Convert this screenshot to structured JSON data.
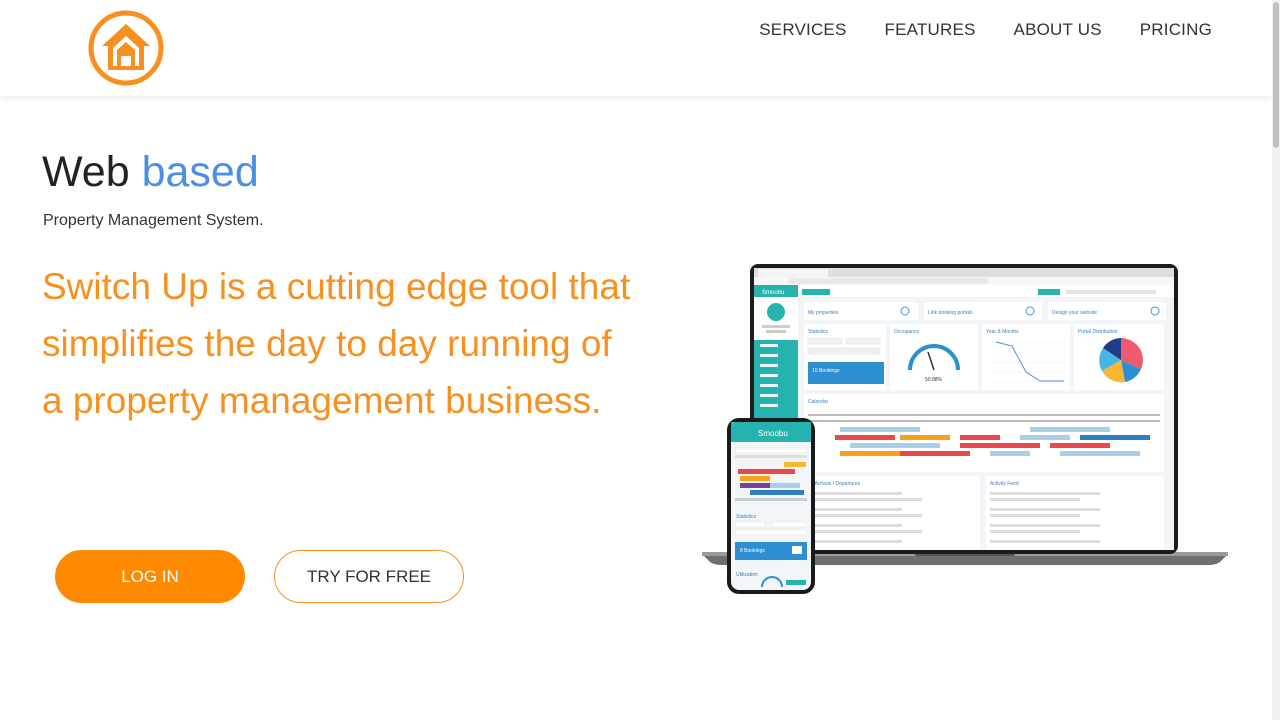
{
  "header": {
    "logo": {
      "icon": "house-icon",
      "color": "#f7901e"
    },
    "nav": [
      {
        "label": "SERVICES"
      },
      {
        "label": "FEATURES"
      },
      {
        "label": "ABOUT US"
      },
      {
        "label": "PRICING"
      }
    ]
  },
  "hero": {
    "headline_part1": "Web",
    "headline_part2": "based",
    "subheadline": "Property Management System.",
    "tagline": "Switch Up is a cutting edge tool that simplifies the day to day running of a property management business.",
    "buttons": {
      "login_label": "LOG IN",
      "try_label": "TRY FOR FREE"
    }
  },
  "mockup": {
    "laptop": {
      "brand": "Smoobu",
      "panels": {
        "my_properties": "My properties",
        "link_portals": "Link booking portals",
        "design_website": "Design your website",
        "statistics": "Statistics",
        "occupancy": "Occupancy",
        "year_months": "Year & Months",
        "portal_distribution": "Portal Distribution",
        "calendar": "Calendar",
        "arrivals": "All Arrivals / Departures",
        "activity": "Activity Feed",
        "bookings": "10 Bookings",
        "occupancy_value": "50.88%"
      }
    },
    "phone": {
      "brand": "Smoobu",
      "statistics": "Statistics",
      "bookings": "8 Bookings",
      "utilization": "Utilization"
    }
  },
  "colors": {
    "accent_orange": "#ff8a00",
    "tagline_orange": "#f7901e",
    "headline_blue": "#4a90e2",
    "app_teal": "#26b3b0"
  }
}
